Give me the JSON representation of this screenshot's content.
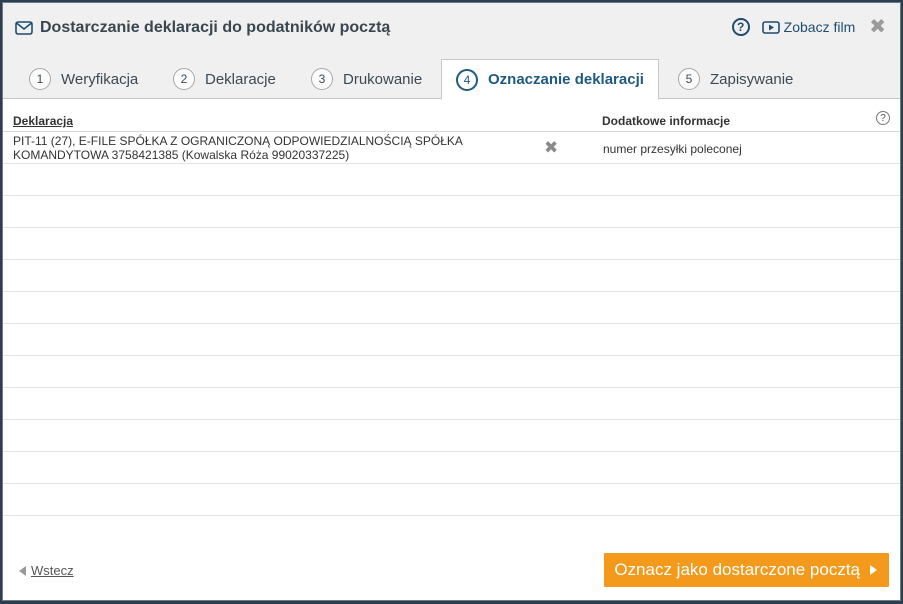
{
  "dialog": {
    "title": "Dostarczanie deklaracji do podatników pocztą",
    "help_label": "?",
    "film_label": "Zobacz film",
    "close_label": "✖"
  },
  "tabs": [
    {
      "num": "1",
      "label": "Weryfikacja"
    },
    {
      "num": "2",
      "label": "Deklaracje"
    },
    {
      "num": "3",
      "label": "Drukowanie"
    },
    {
      "num": "4",
      "label": "Oznaczanie deklaracji"
    },
    {
      "num": "5",
      "label": "Zapisywanie"
    }
  ],
  "active_tab": 3,
  "table": {
    "col_declaration": "Deklaracja",
    "col_info": "Dodatkowe informacje",
    "help_label": "?",
    "rows": [
      {
        "declaration": "PIT-11 (27), E-FILE SPÓŁKA Z OGRANICZONĄ ODPOWIEDZIALNOŚCIĄ SPÓŁKA KOMANDYTOWA 3758421385 (Kowalska Róża 99020337225)",
        "remove_label": "✖",
        "info": "numer przesyłki poleconej"
      }
    ],
    "empty_rows": 11
  },
  "footer": {
    "back_label": "Wstecz",
    "primary_label": "Oznacz jako dostarczone pocztą"
  },
  "colors": {
    "accent": "#1f5a80",
    "primary_button": "#f39a1c",
    "frame": "#2d3e4e"
  }
}
